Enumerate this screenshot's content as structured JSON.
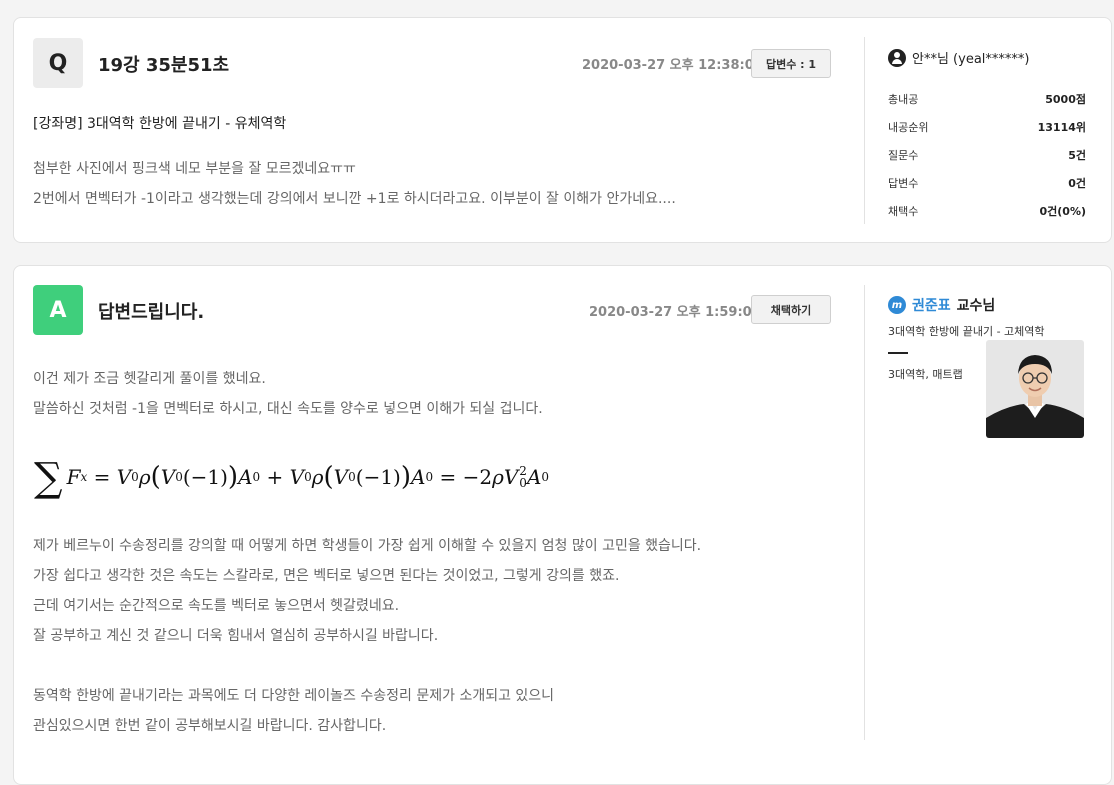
{
  "question": {
    "badge": "Q",
    "title": "19강 35분51초",
    "date": "2020-03-27 오후 12:38:00",
    "answers_button": "답변수 : 1",
    "course": "[강좌명] 3대역학 한방에 끝내기 - 유체역학",
    "body": [
      "첨부한 사진에서 핑크색 네모 부분을 잘 모르겠네요ㅠㅠ",
      "2번에서 면벡터가 -1이라고 생각했는데 강의에서 보니깐 +1로 하시더라고요. 이부분이 잘 이해가 안가네요...."
    ],
    "user": {
      "name": "안**님 (yeal******)",
      "icon": "user-circle-icon",
      "stats": [
        {
          "label": "총내공",
          "value": "5000점"
        },
        {
          "label": "내공순위",
          "value": "13114위"
        },
        {
          "label": "질문수",
          "value": "5건"
        },
        {
          "label": "답변수",
          "value": "0건"
        },
        {
          "label": "채택수",
          "value": "0건(0%)"
        }
      ]
    }
  },
  "answer": {
    "badge": "A",
    "title": "답변드립니다.",
    "date": "2020-03-27 오후 1:59:00",
    "select_button": "채택하기",
    "body_top": [
      "이건 제가 조금 헷갈리게 풀이를 했네요.",
      "말씀하신 것처럼 -1을 면벡터로 하시고, 대신 속도를 양수로 넣으면 이해가 되실 겁니다."
    ],
    "body_bottom": [
      "제가 베르누이 수송정리를 강의할 때 어떻게 하면 학생들이 가장 쉽게 이해할 수 있을지 엄청 많이 고민을 했습니다.",
      "가장 쉽다고 생각한 것은 속도는 스칼라로, 면은 벡터로 넣으면 된다는 것이었고, 그렇게 강의를 했죠.",
      "근데 여기서는 순간적으로 속도를 벡터로 놓으면서 헷갈렸네요.",
      "잘 공부하고 계신 것 같으니 더욱 힘내서 열심히 공부하시길 바랍니다.",
      "동역학 한방에 끝내기라는 과목에도 더 다양한 레이놀즈 수송정리 문제가 소개되고 있으니",
      "관심있으시면 한번 같이 공부해보시길 바랍니다. 감사합니다."
    ],
    "professor": {
      "logo_icon": "professor-logo-icon",
      "name": "권준표",
      "suffix": "교수님",
      "course": "3대역학 한방에 끝내기 - 고체역학",
      "tags": "3대역학, 매트랩"
    }
  },
  "colors": {
    "answer_badge": "#3fcf7c",
    "question_badge": "#ececec",
    "professor_name": "#2f8ad6"
  }
}
